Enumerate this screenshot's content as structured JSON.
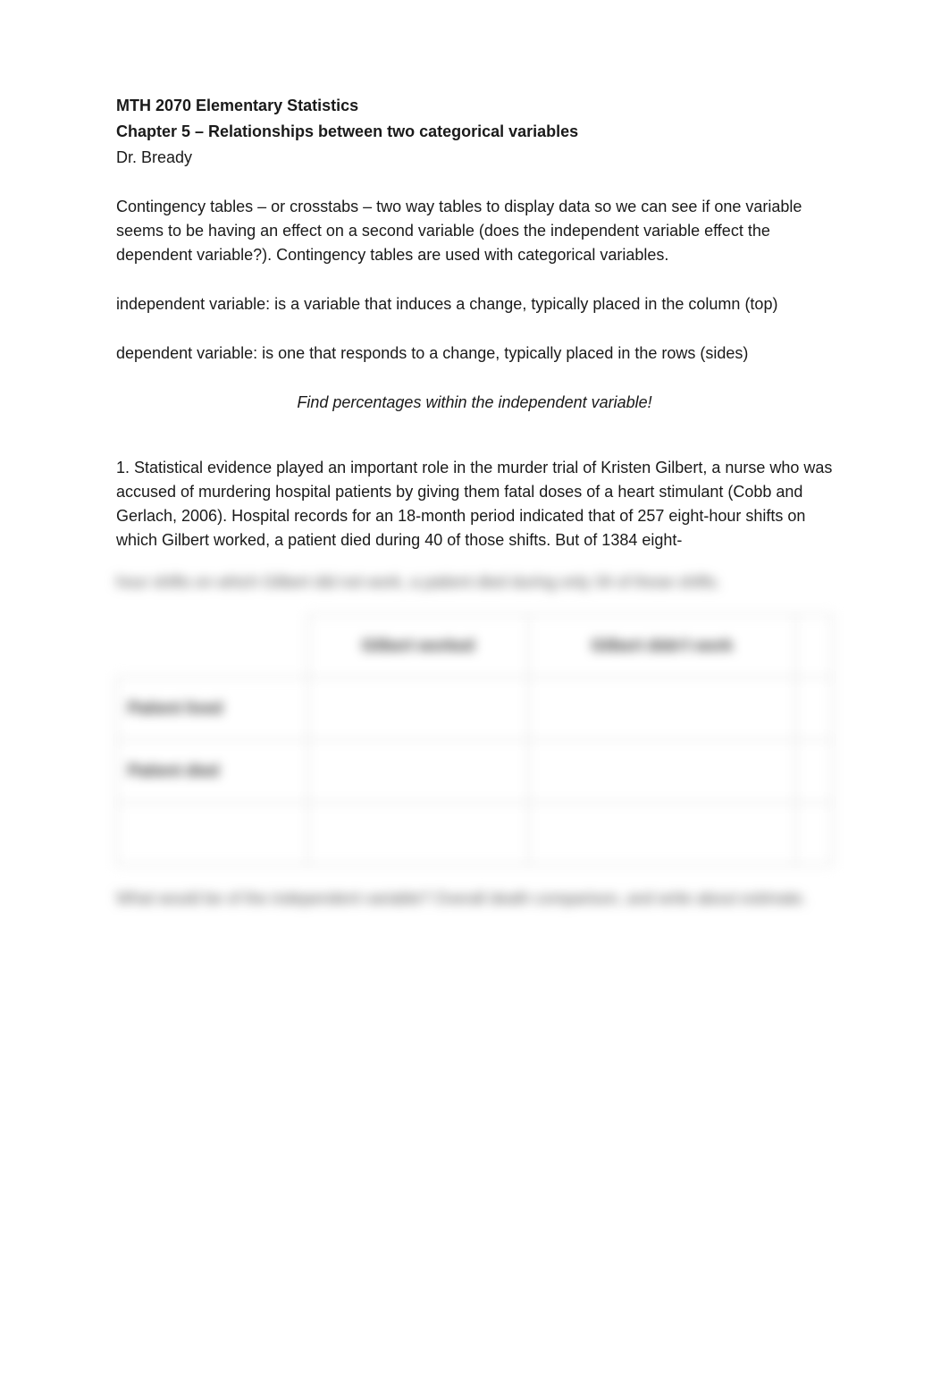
{
  "header": {
    "course": "MTH 2070 Elementary Statistics",
    "chapter": "Chapter 5 – Relationships between two categorical variables",
    "instructor": "Dr. Bready"
  },
  "intro": {
    "contingency": "Contingency tables  – or crosstabs – two way tables to display data so we can see if one variable seems to be having an effect on a second variable (does the independent variable effect the dependent variable?).  Contingency tables are used with categorical variables.",
    "independent": "independent variable: is a variable that induces a change, typically placed in the column (top)",
    "dependent": "dependent variable: is one that responds to a change, typically placed in the rows (sides)",
    "findpct": "Find percentages within the independent variable!"
  },
  "problem1": {
    "text": "1.  Statistical evidence played an important role in the murder trial of Kristen Gilbert, a nurse who was accused of murdering hospital patients by giving them fatal doses of a heart stimulant (Cobb and Gerlach, 2006).  Hospital records for an 18-month period indicated that of 257 eight-hour shifts on which Gilbert worked, a patient died during 40 of those shifts.  But of 1384 eight-",
    "blurred_line": "hour shifts on which Gilbert did not work, a patient died during only 34 of those shifts.",
    "table": {
      "col1": "Gilbert worked",
      "col2": "Gilbert didn't work",
      "row1": "Patient lived",
      "row2": "Patient died"
    },
    "below": "What would be of the independent variable?   Overall death comparison, and write about estimate."
  }
}
